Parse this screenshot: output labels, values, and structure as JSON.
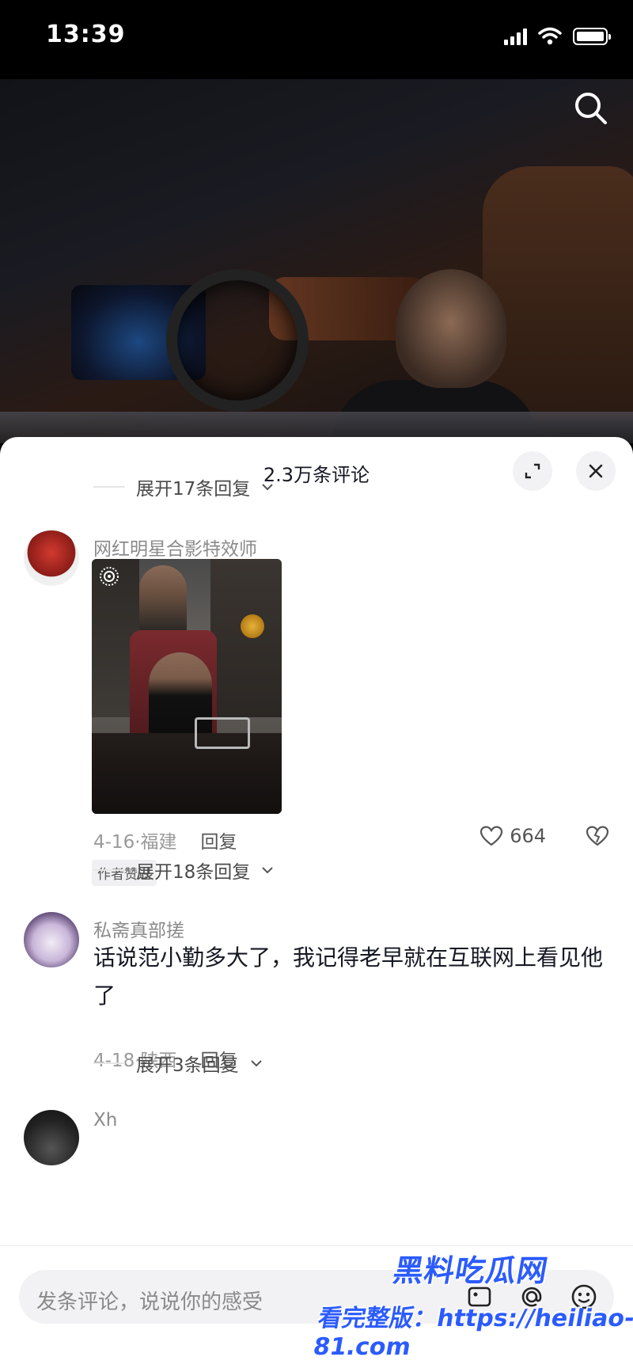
{
  "status_bar": {
    "time": "13:39"
  },
  "comments_panel": {
    "title": "2.3万条评论",
    "top_expand": "展开17条回复"
  },
  "comments": [
    {
      "username": "网红明星合影特效师",
      "date_location": "4-16·福建",
      "reply_label": "回复",
      "likes": "664",
      "badge": "作者赞过",
      "expand_replies": "展开18条回复"
    },
    {
      "username": "私斋真部搓",
      "text": "话说范小勤多大了，我记得老早就在互联网上看见他了",
      "date_location": "4-18·陕西",
      "reply_label": "回复",
      "expand_replies": "展开3条回复"
    },
    {
      "username": "Xh"
    }
  ],
  "input_bar": {
    "placeholder": "发条评论，说说你的感受"
  },
  "watermark": {
    "line1": "黑料吃瓜网",
    "line2": "看完整版：https://heiliao-81.com"
  },
  "colors": {
    "accent_link": "#2b5bff",
    "sheet_bg": "#ffffff",
    "text_primary": "#161823"
  }
}
